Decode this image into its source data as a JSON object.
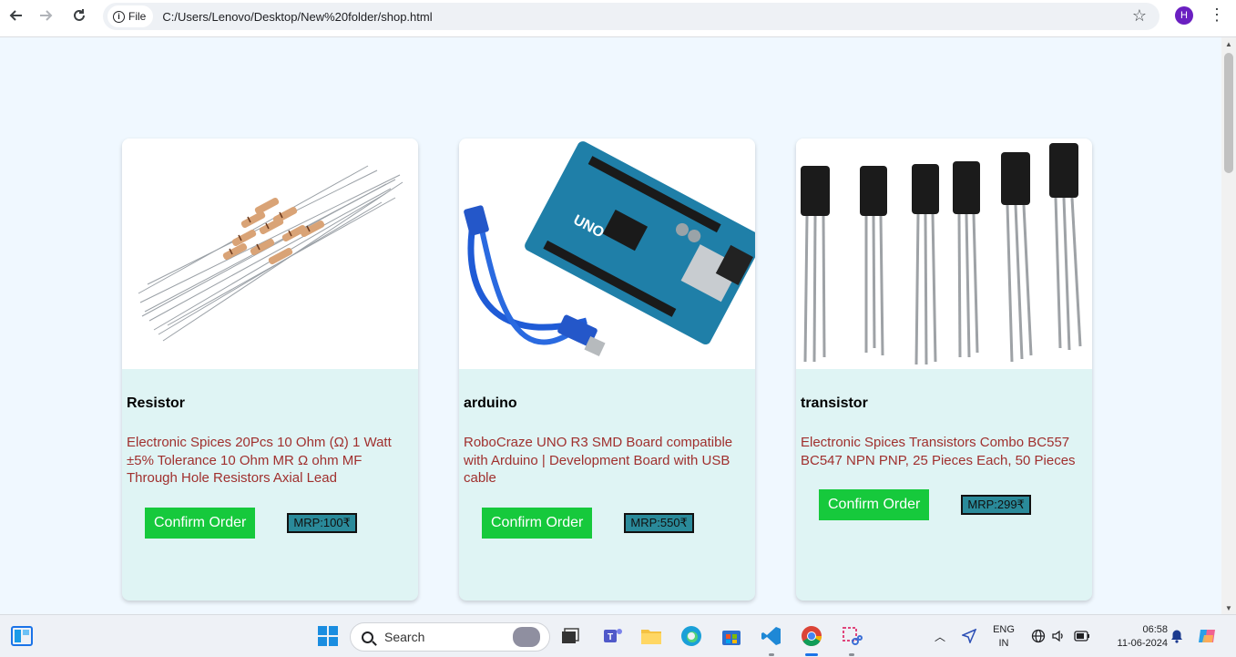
{
  "browser": {
    "chip_label": "File",
    "url": "C:/Users/Lenovo/Desktop/New%20folder/shop.html",
    "profile_initial": "H",
    "icons": [
      "back-icon",
      "forward-icon",
      "reload-icon",
      "info-icon",
      "star-icon",
      "kebab-menu-icon"
    ]
  },
  "products": [
    {
      "name": "Resistor",
      "description": "Electronic Spices 20Pcs 10 Ohm (Ω) 1 Watt ±5% Tolerance 10 Ohm MR Ω ohm MF Through Hole Resistors Axial Lead",
      "button": "Confirm Order",
      "mrp": "MRP:100₹"
    },
    {
      "name": "arduino",
      "description": "RoboCraze UNO R3 SMD Board compatible with Arduino | Development Board with USB cable",
      "button": "Confirm Order",
      "mrp": "MRP:550₹"
    },
    {
      "name": "transistor",
      "description": "Electronic Spices Transistors Combo BC557 BC547 NPN PNP, 25 Pieces Each, 50 Pieces",
      "button": "Confirm Order",
      "mrp": "MRP:299₹"
    }
  ],
  "taskbar": {
    "search_label": "Search",
    "language_top": "ENG",
    "language_bottom": "IN",
    "time": "06:58",
    "date": "11-06-2024"
  },
  "colors": {
    "page_bg": "#f0f8ff",
    "card_bg": "#dff4f4",
    "confirm_button": "#16c93c",
    "mrp_badge": "#2a8a9a",
    "description_text": "#a0302e"
  }
}
